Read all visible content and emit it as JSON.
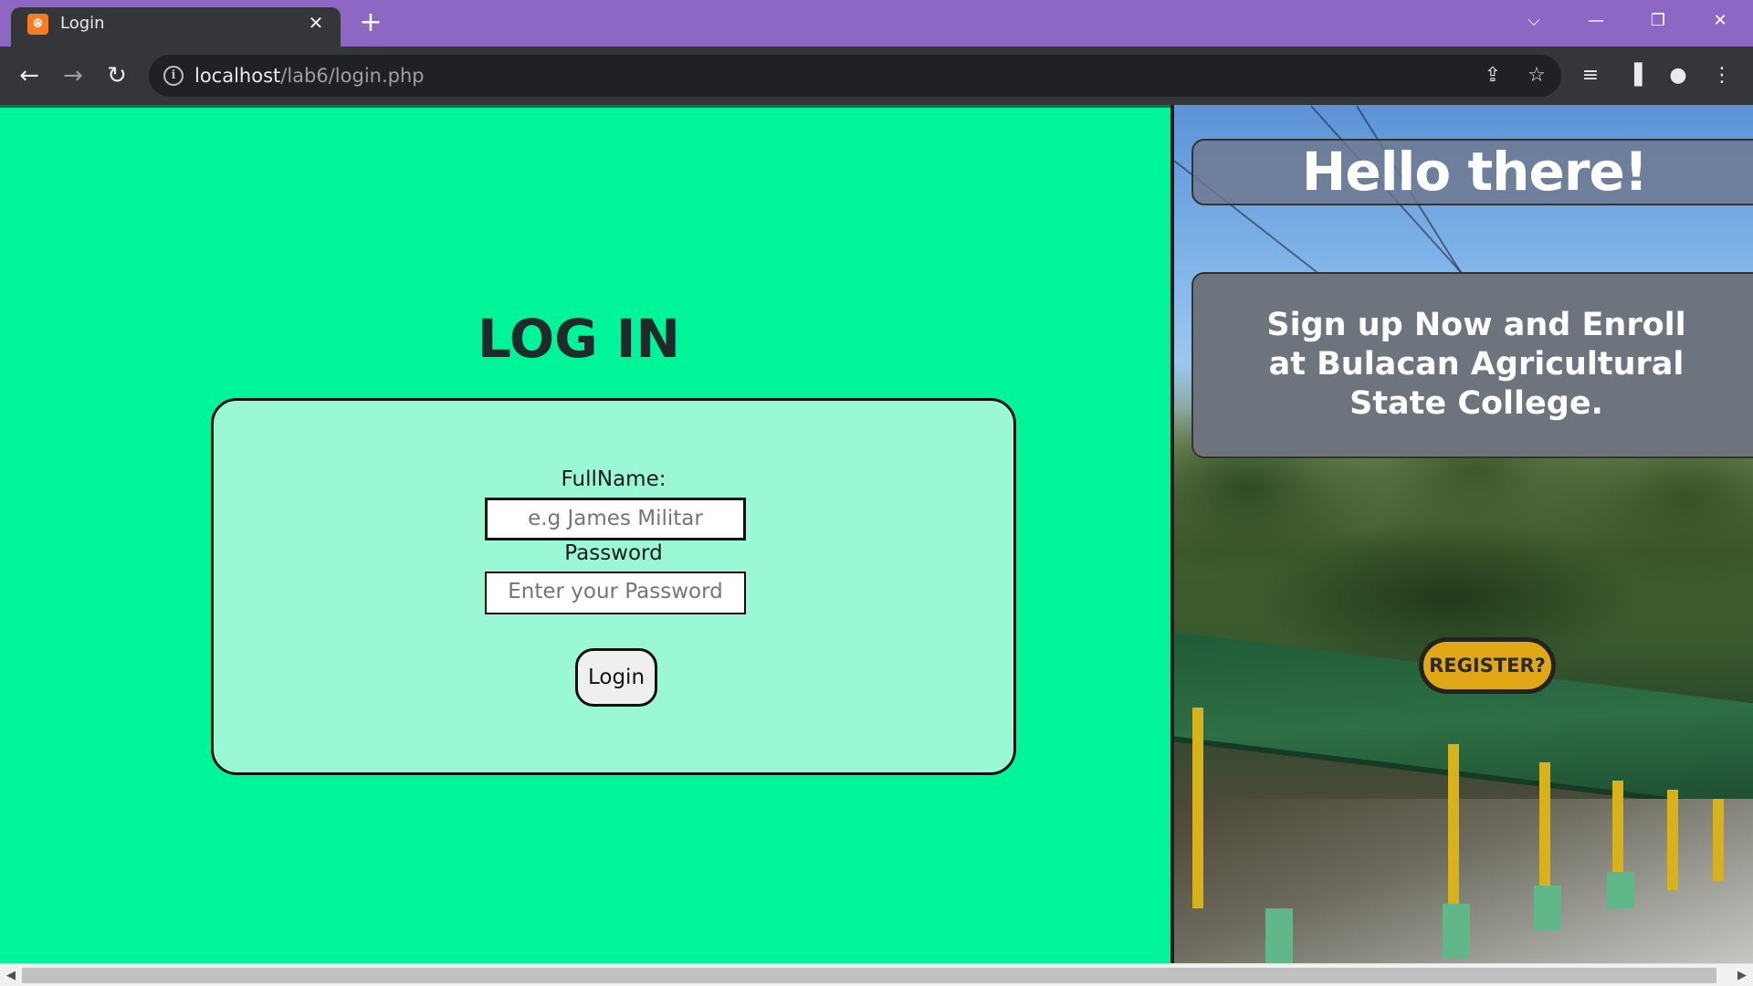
{
  "browser": {
    "tab_title": "Login",
    "tab_favicon": "xampp-favicon",
    "url_host": "localhost",
    "url_path": "/lab6/login.php",
    "accent_color": "#8e67c4"
  },
  "login": {
    "title": "LOG IN",
    "fullname_label": "FullName:",
    "fullname_placeholder": "e.g James Militar",
    "password_label": "Password",
    "password_placeholder": "Enter your Password",
    "login_button": "Login",
    "page_bg_color": "#00f599",
    "card_bg_color": "#9af8d5"
  },
  "promo": {
    "greeting": "Hello there!",
    "message": "Sign up Now and Enroll at Bulacan Agricultural State College.",
    "register_button": "REGISTER?",
    "register_color": "#e0a817"
  }
}
